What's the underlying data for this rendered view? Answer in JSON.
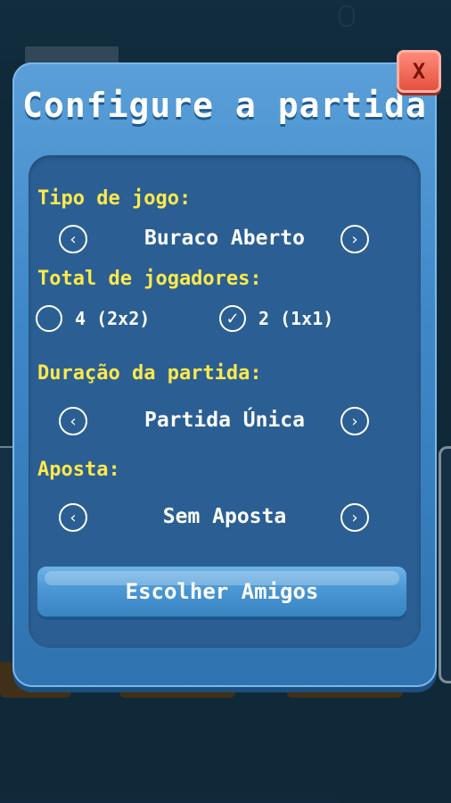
{
  "dialog": {
    "title": "Configure a partida",
    "close_label": "X"
  },
  "game_type": {
    "label": "Tipo de jogo:",
    "value": "Buraco Aberto"
  },
  "players": {
    "label": "Total de jogadores:",
    "options": [
      {
        "label": "4 (2x2)",
        "selected": false
      },
      {
        "label": "2 (1x1)",
        "selected": true
      }
    ]
  },
  "duration": {
    "label": "Duração da partida:",
    "value": "Partida Única"
  },
  "bet": {
    "label": "Aposta:",
    "value": "Sem Aposta"
  },
  "actions": {
    "choose_friends": "Escolher Amigos"
  },
  "icons": {
    "prev": "chevron-left-icon",
    "next": "chevron-right-icon",
    "check": "checkmark-icon"
  },
  "colors": {
    "accent_label": "#ffe94a",
    "dialog_bg": "#3f88c8",
    "panel_bg": "#2b5f93",
    "close_bg": "#e4513f"
  }
}
